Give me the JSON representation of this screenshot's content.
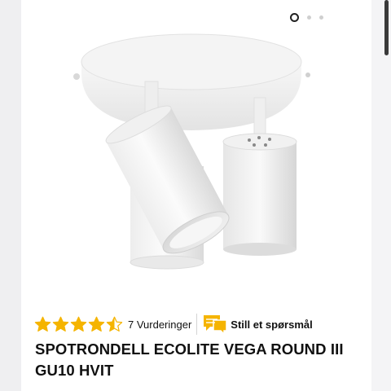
{
  "carousel": {
    "count": 3,
    "active_index": 0
  },
  "product": {
    "rating_value": 4.5,
    "rating_max": 5,
    "reviews_label": "7 Vurderinger",
    "ask_question_label": "Still et spørsmål",
    "title_line1": "SPOTRONDELL ECOLITE VEGA ROUND III",
    "title_line2": "GU10 HVIT"
  },
  "colors": {
    "star": "#f5b400",
    "question_icon": "#f5b400",
    "text": "#111111"
  },
  "icons": {
    "star": "star-icon",
    "question": "speech-bubble-icon"
  }
}
